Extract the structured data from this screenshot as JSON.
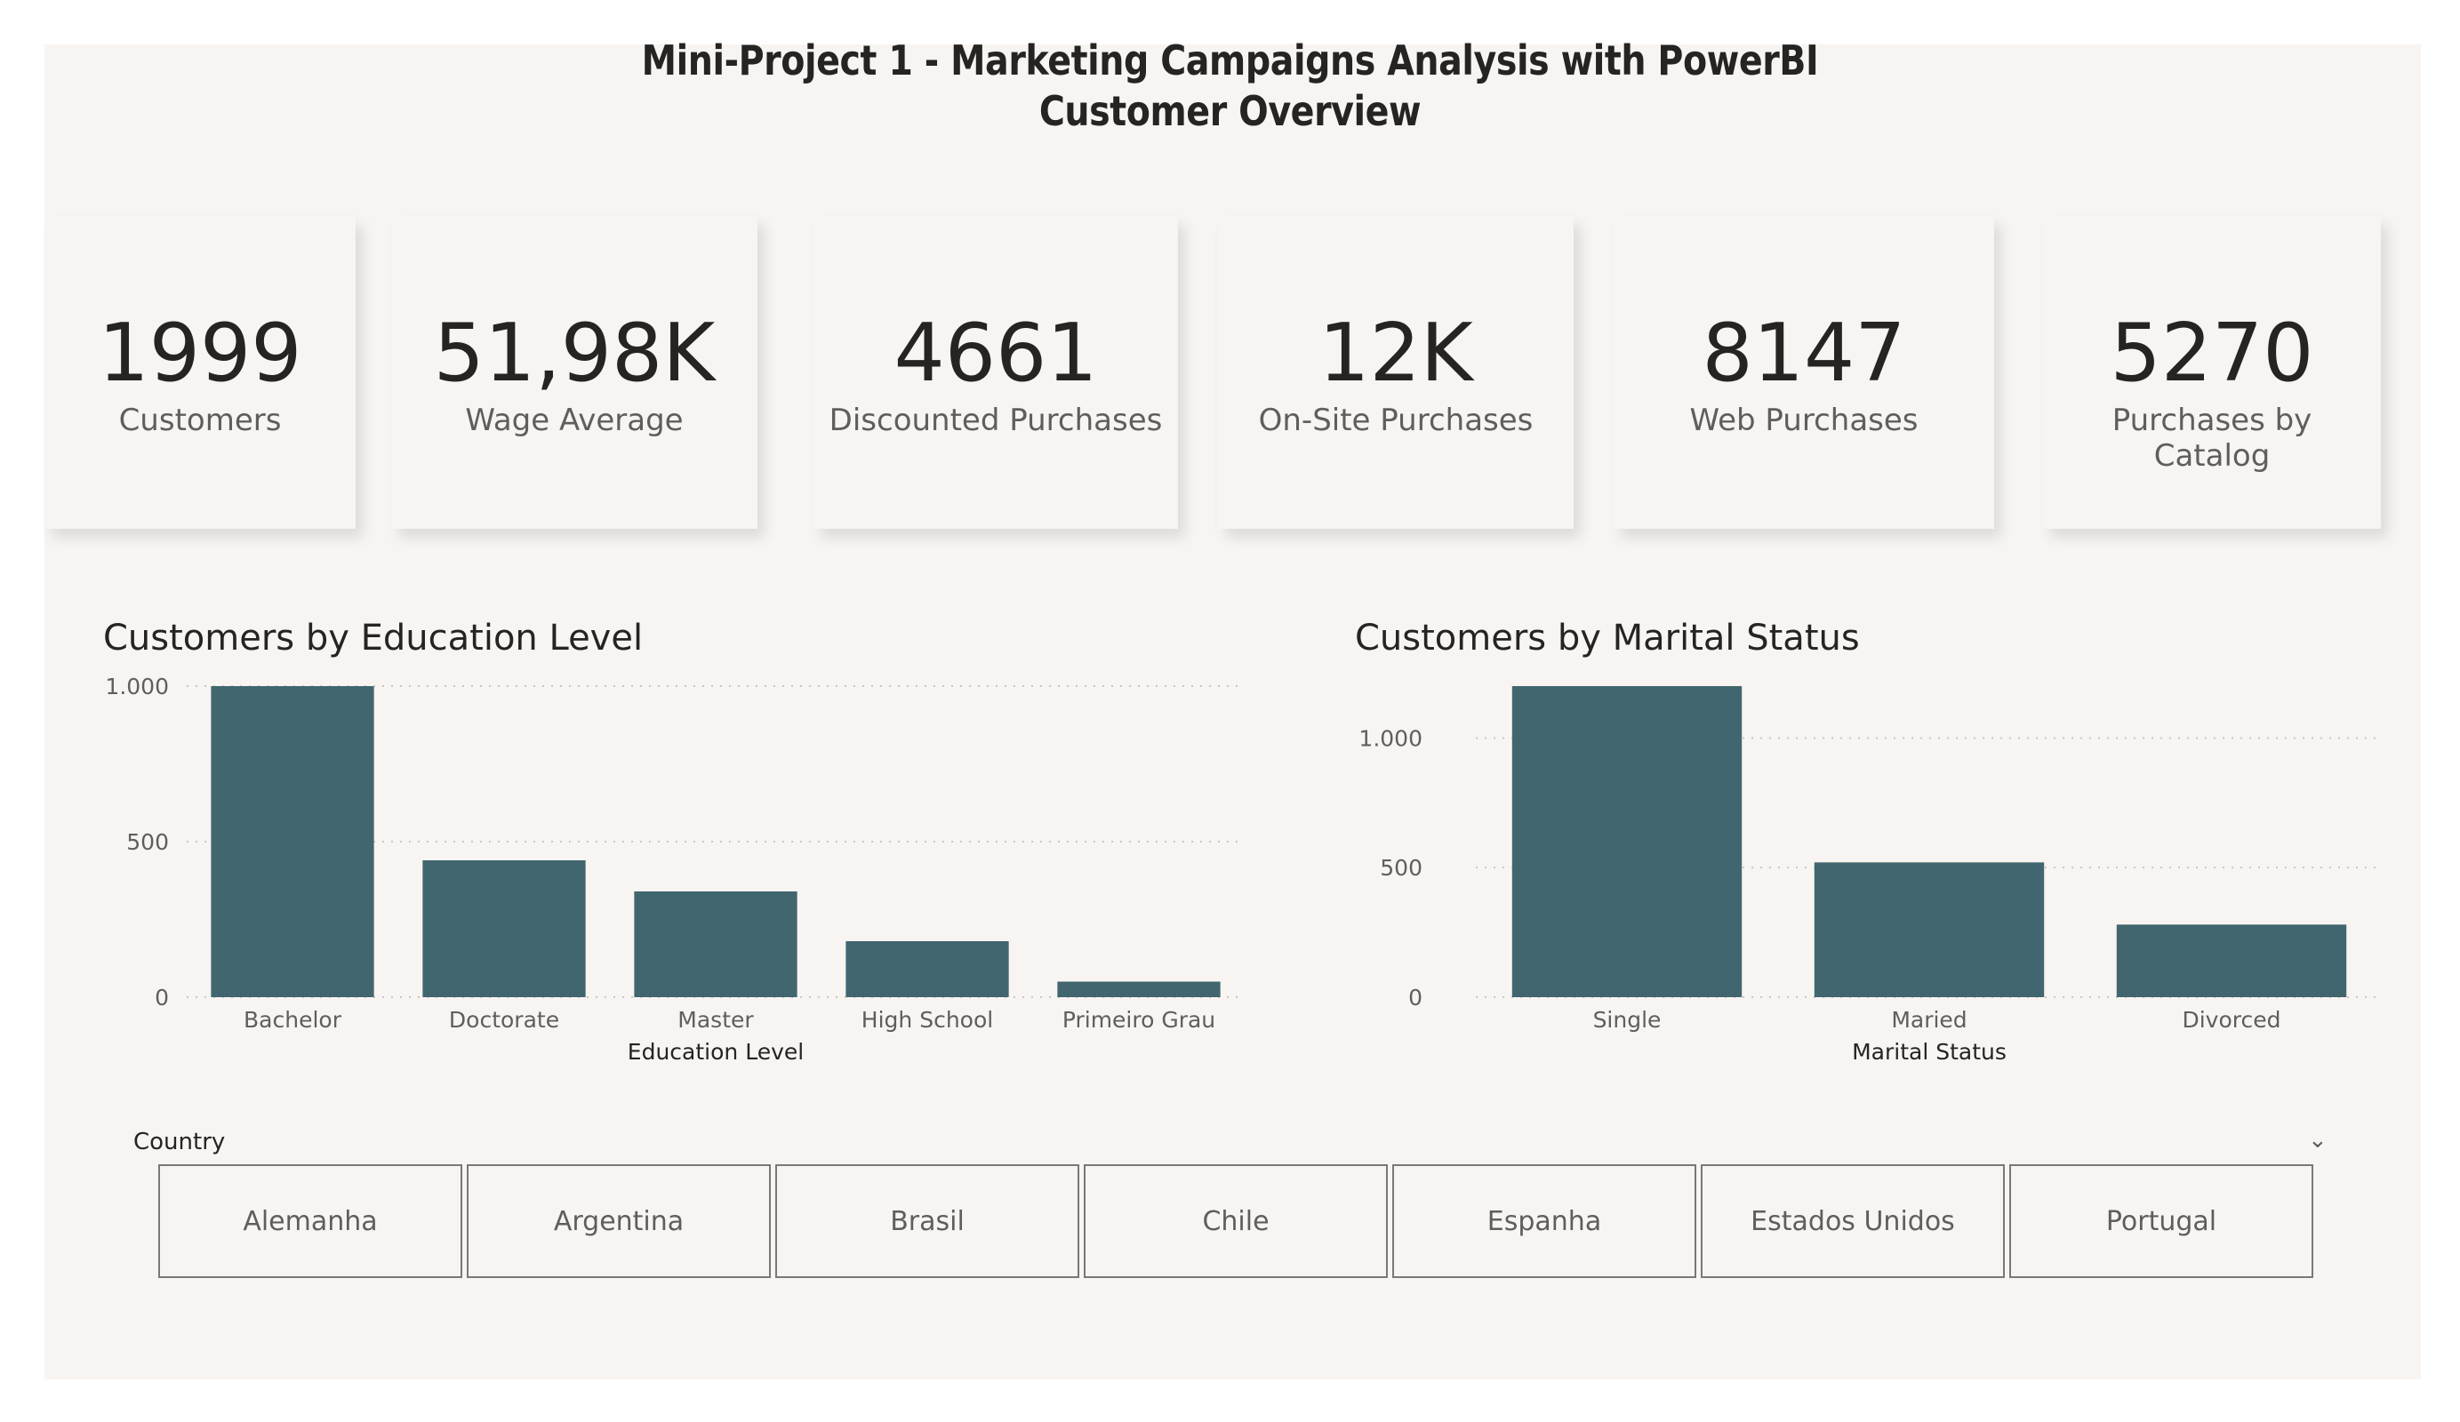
{
  "header": {
    "title_line1": "Mini-Project 1 - Marketing Campaigns Analysis with PowerBI",
    "title_line2": "Customer Overview"
  },
  "kpis": [
    {
      "value": "1999",
      "label": "Customers"
    },
    {
      "value": "51,98K",
      "label": "Wage Average"
    },
    {
      "value": "4661",
      "label": "Discounted Purchases"
    },
    {
      "value": "12K",
      "label": "On-Site Purchases"
    },
    {
      "value": "8147",
      "label": "Web Purchases"
    },
    {
      "value": "5270",
      "label": "Purchases by Catalog"
    }
  ],
  "colors": {
    "bar": "#41666f",
    "background": "#f7f4f1",
    "text": "#252423",
    "muted": "#605e5c"
  },
  "chart_data": [
    {
      "type": "bar",
      "title": "Customers by Education Level",
      "xlabel": "Education Level",
      "ylabel": "",
      "categories": [
        "Bachelor",
        "Doctorate",
        "Master",
        "High School",
        "Primeiro Grau"
      ],
      "values": [
        1000,
        440,
        340,
        180,
        50
      ],
      "ylim": [
        0,
        1000
      ],
      "yticks": [
        0,
        500,
        1000
      ],
      "ytick_labels": [
        "0",
        "500",
        "1.000"
      ],
      "grid": true
    },
    {
      "type": "bar",
      "title": "Customers by Marital Status",
      "xlabel": "Marital Status",
      "ylabel": "",
      "categories": [
        "Single",
        "Maried",
        "Divorced"
      ],
      "values": [
        1200,
        520,
        280
      ],
      "ylim": [
        0,
        1200
      ],
      "yticks": [
        0,
        500,
        1000
      ],
      "ytick_labels": [
        "0",
        "500",
        "1.000"
      ],
      "grid": true
    }
  ],
  "slicer": {
    "header": "Country",
    "expand_icon": "chevron-down-icon",
    "options": [
      "Alemanha",
      "Argentina",
      "Brasil",
      "Chile",
      "Espanha",
      "Estados Unidos",
      "Portugal"
    ]
  }
}
